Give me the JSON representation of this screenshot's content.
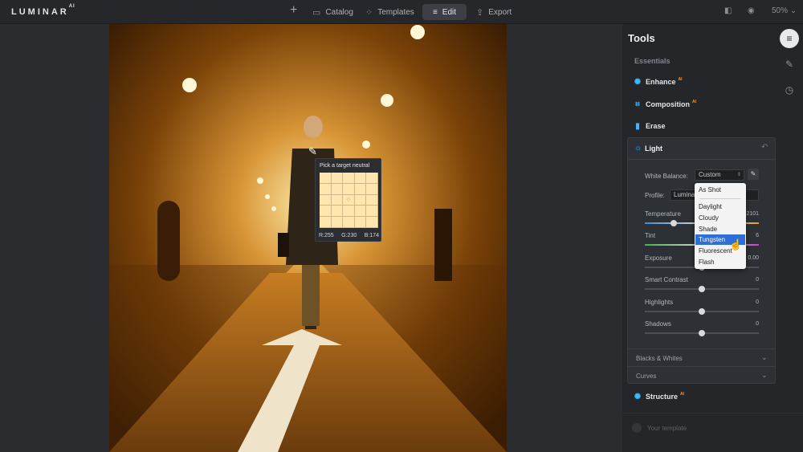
{
  "app": {
    "logo": "LUMINAR",
    "logo_sup": "AI"
  },
  "topnav": {
    "add_label": "+",
    "catalog": "Catalog",
    "templates": "Templates",
    "edit": "Edit",
    "export": "Export",
    "zoom": "50%"
  },
  "picker": {
    "title": "Pick a target neutral",
    "r": "R:255",
    "g": "G:230",
    "b": "B:174",
    "swatch_color": "#ffe6ae"
  },
  "panel": {
    "title": "Tools",
    "essentials": "Essentials",
    "tools": [
      {
        "label": "Enhance",
        "ai": "AI",
        "icon": "sparkle-icon"
      },
      {
        "label": "Composition",
        "ai": "AI",
        "icon": "crop-icon"
      },
      {
        "label": "Erase",
        "ai": "",
        "icon": "eraser-icon"
      }
    ],
    "light": {
      "title": "Light",
      "white_balance_label": "White Balance:",
      "white_balance_value": "Custom",
      "profile_label": "Profile:",
      "profile_value": "Lumina",
      "sliders": [
        {
          "label": "Temperature",
          "value": "2101",
          "level": 0.25
        },
        {
          "label": "Tint",
          "value": "6",
          "level": 0.53
        },
        {
          "label": "Exposure",
          "value": "0.00",
          "level": 0.5
        },
        {
          "label": "Smart Contrast",
          "value": "0",
          "level": 0.5
        },
        {
          "label": "Highlights",
          "value": "0",
          "level": 0.5
        },
        {
          "label": "Shadows",
          "value": "0",
          "level": 0.5
        }
      ],
      "sections": [
        "Blacks & Whites",
        "Curves"
      ]
    },
    "structure": {
      "label": "Structure",
      "ai": "AI"
    },
    "template": "Your template"
  },
  "dropdown": {
    "options": [
      "As Shot",
      "Daylight",
      "Cloudy",
      "Shade",
      "Tungsten",
      "Fluorescent",
      "Flash"
    ],
    "selected": "Tungsten"
  },
  "colors": {
    "accent": "#3fb6ff",
    "ai_badge": "#ff9a2e",
    "selection": "#2f6ed4"
  }
}
